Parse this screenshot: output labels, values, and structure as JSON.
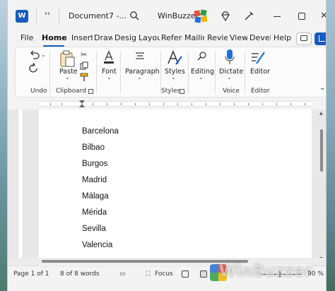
{
  "titlebar": {
    "app_icon": "word-logo",
    "qa_more": "››",
    "doc_title": "Document7 -...",
    "account_name": "WinBuzzer ."
  },
  "tabs": [
    "File",
    "Home",
    "Insert",
    "Draw",
    "Design",
    "Layout",
    "References",
    "Mailings",
    "Review",
    "View",
    "Developer",
    "Help"
  ],
  "active_tab": "Home",
  "ribbon": {
    "undo_group": "Undo",
    "paste_label": "Paste",
    "clipboard_group": "Clipboard",
    "font_label": "Font",
    "paragraph_label": "Paragraph",
    "styles_label": "Styles",
    "styles_group": "Styles",
    "editing_label": "Editing",
    "dictate_label": "Dictate",
    "voice_group": "Voice",
    "editor_label": "Editor",
    "editor_group": "Editor"
  },
  "document": {
    "lines": [
      "Barcelona",
      "Bilbao",
      "Burgos",
      "Madrid",
      "Málaga",
      "Mérida",
      "Sevilla",
      "Valencia"
    ]
  },
  "statusbar": {
    "page": "Page 1 of 1",
    "words": "8 of 8 words",
    "focus": "Focus",
    "zoom": "90 %"
  },
  "watermark": "WinBuzzer",
  "colors": {
    "accent": "#185abd",
    "ribbon_bg": "#fbfbfb",
    "chrome_bg": "#f3f3f3"
  }
}
